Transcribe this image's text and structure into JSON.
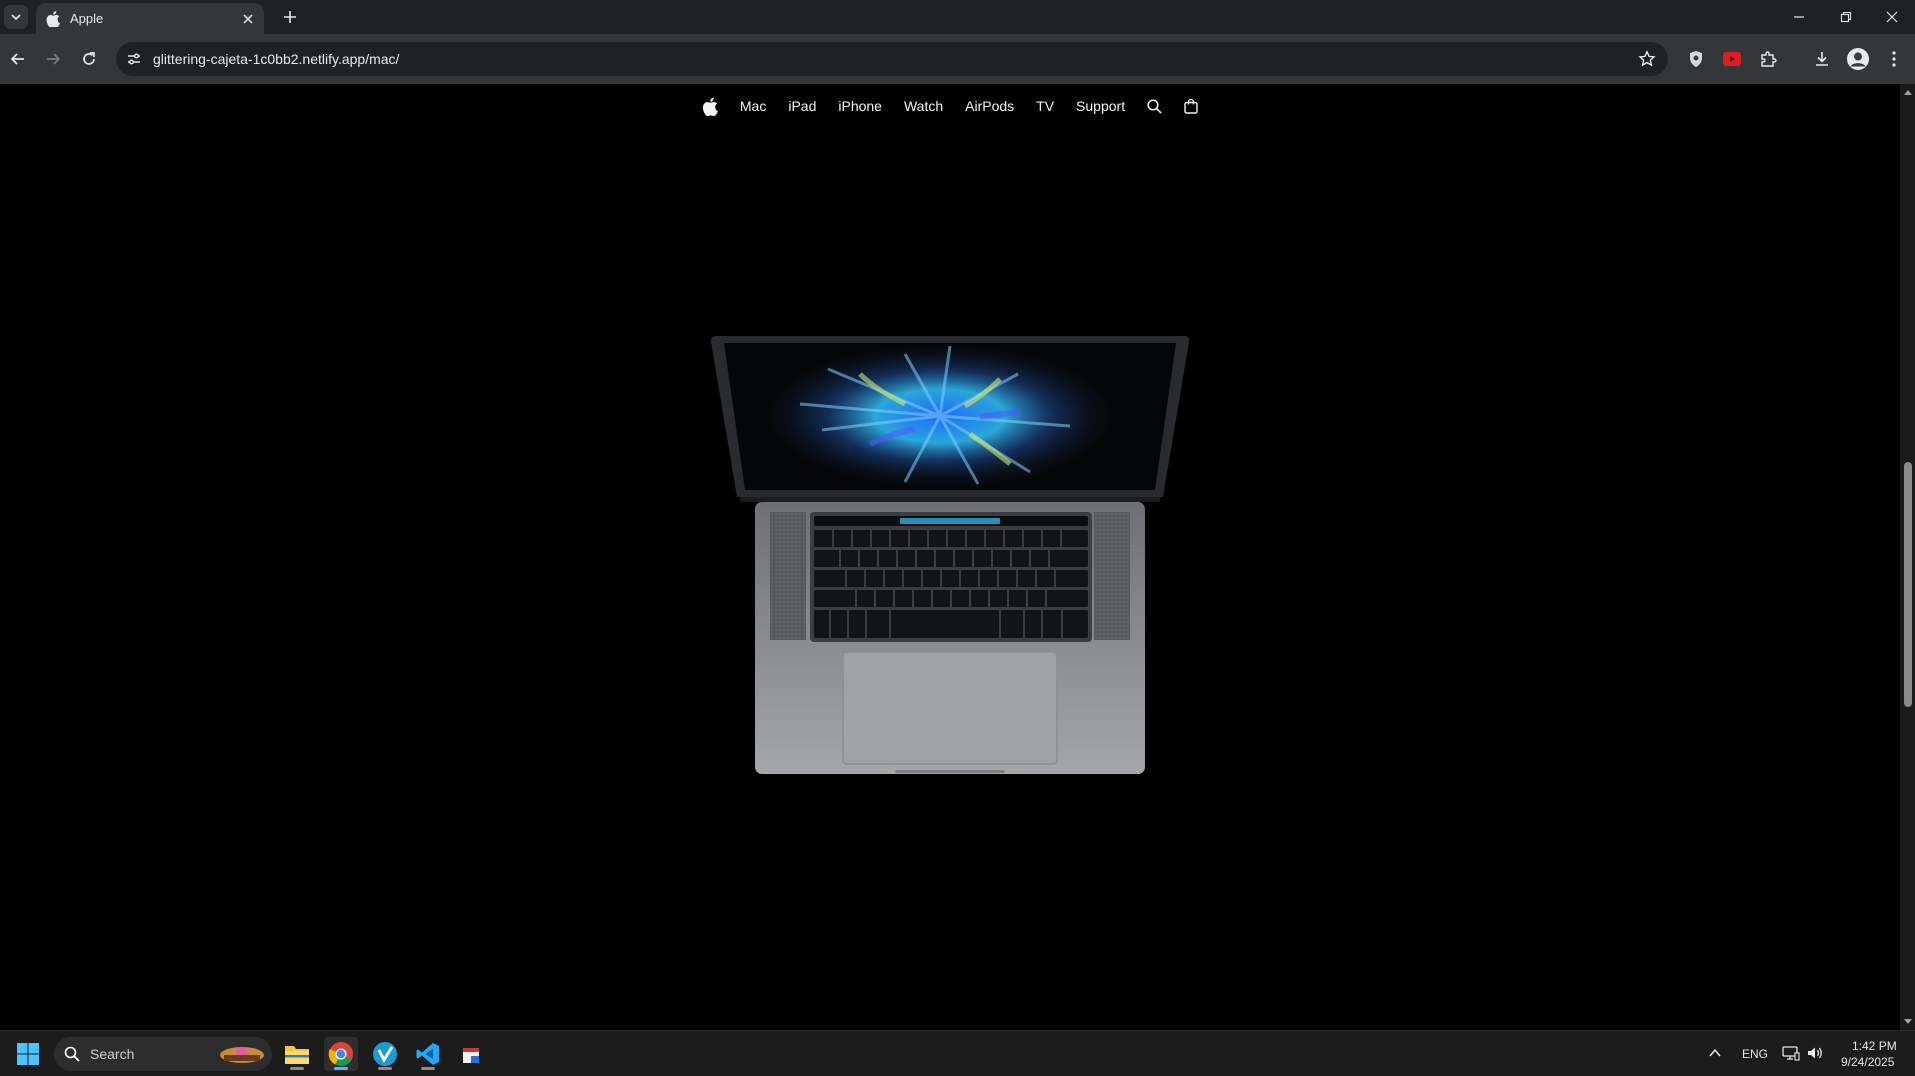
{
  "browser": {
    "tab_title": "Apple",
    "url": "glittering-cajeta-1c0bb2.netlify.app/mac/"
  },
  "globalnav": {
    "items": [
      "Mac",
      "iPad",
      "iPhone",
      "Watch",
      "AirPods",
      "TV",
      "Support"
    ]
  },
  "taskbar": {
    "search_placeholder": "Search",
    "language": "ENG",
    "time": "1:42 PM",
    "date": "9/24/2025"
  },
  "colors": {
    "page_bg": "#000000",
    "nav_text": "#f5f5f7",
    "chrome_dark": "#202124",
    "chrome_toolbar": "#35363a"
  }
}
